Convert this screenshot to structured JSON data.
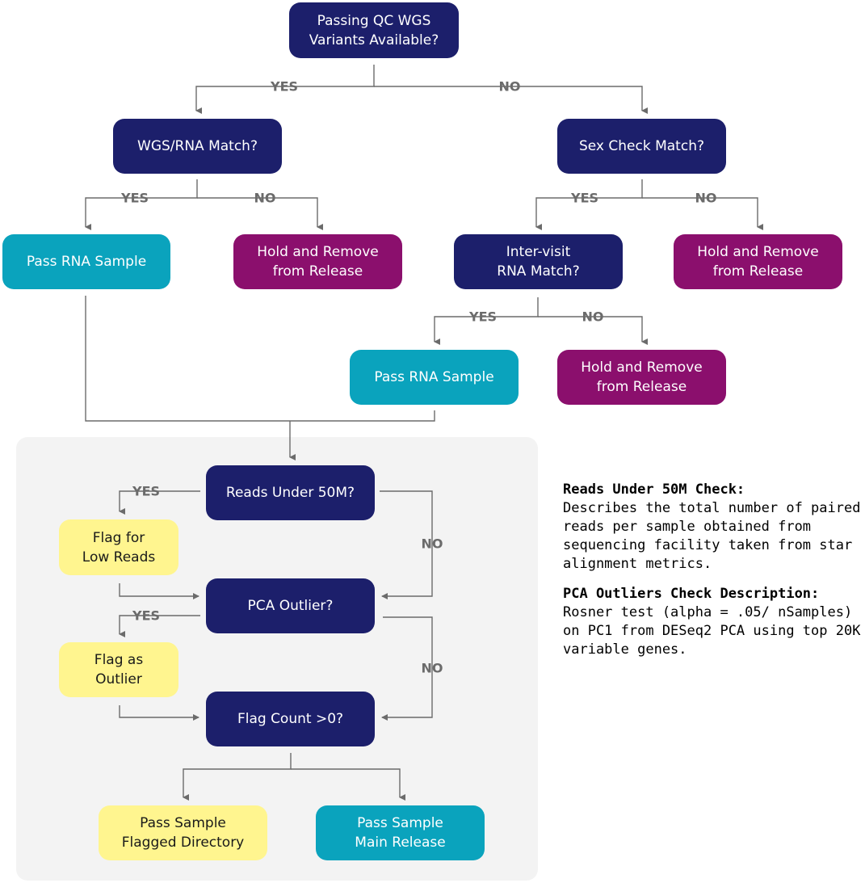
{
  "nodes": {
    "wgs_available": "Passing QC WGS\nVariants Available?",
    "wgs_rna_match": "WGS/RNA Match?",
    "sex_check": "Sex Check Match?",
    "pass_rna_1": "Pass RNA Sample",
    "hold_1": "Hold and Remove\nfrom Release",
    "intervisit": "Inter-visit\nRNA Match?",
    "hold_2": "Hold and Remove\nfrom Release",
    "pass_rna_2": "Pass RNA Sample",
    "hold_3": "Hold and Remove\nfrom Release",
    "reads_under": "Reads Under 50M?",
    "flag_low_reads": "Flag for\nLow Reads",
    "pca_outlier": "PCA Outlier?",
    "flag_outlier": "Flag as\nOutlier",
    "flag_count": "Flag Count >0?",
    "pass_flagged": "Pass Sample\nFlagged Directory",
    "pass_main": "Pass Sample\nMain Release"
  },
  "edge_labels": {
    "yes": "YES",
    "no": "NO"
  },
  "notes": [
    {
      "heading": "Reads Under 50M Check:",
      "body": "Describes the total number of paired reads per sample obtained from sequencing facility taken from star alignment metrics."
    },
    {
      "heading": "PCA Outliers Check Description:",
      "body": "Rosner test (alpha = .05/ nSamples) on PC1 from DESeq2 PCA using top 20K variable genes."
    }
  ],
  "colors": {
    "decision": "#1c1f6b",
    "pass": "#0aa3bd",
    "hold": "#8b0f6d",
    "flag": "#fff58f",
    "connector": "#6b6b6b",
    "panel": "#f3f3f3"
  }
}
